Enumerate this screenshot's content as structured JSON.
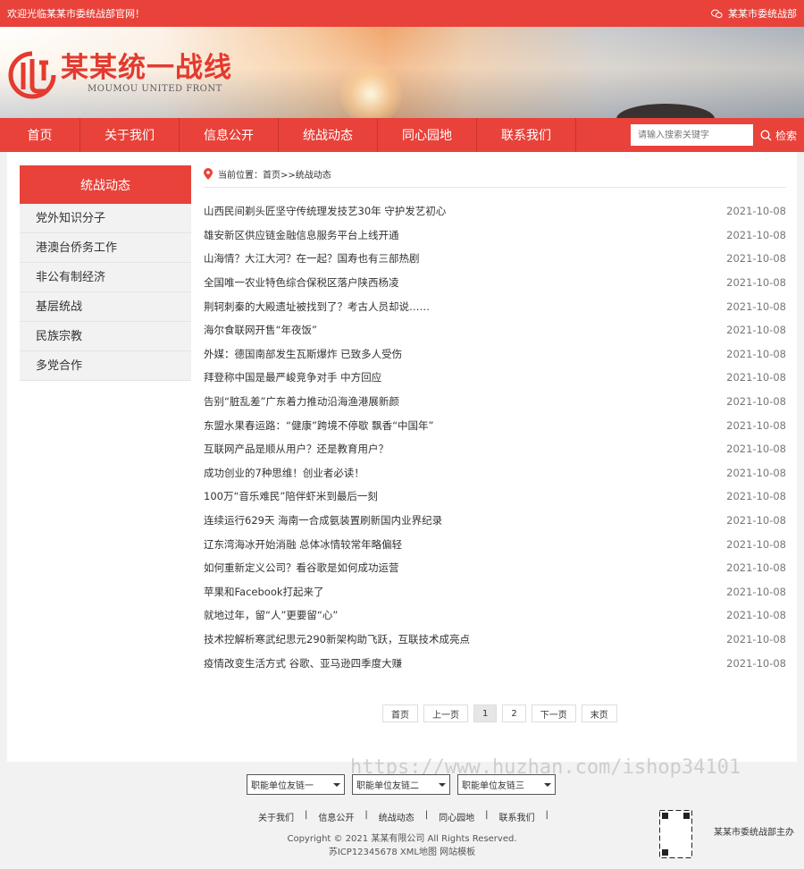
{
  "topbar": {
    "welcome": "欢迎光临某某市委统战部官网！",
    "right_text": "某某市委统战部"
  },
  "logo": {
    "cn": "某某统一战线",
    "en": "MOUMOU UNITED FRONT"
  },
  "nav": {
    "items": [
      "首页",
      "关于我们",
      "信息公开",
      "统战动态",
      "同心园地",
      "联系我们"
    ],
    "search_placeholder": "请输入搜索关键字",
    "search_label": "检索"
  },
  "sidebar": {
    "title": "统战动态",
    "items": [
      "党外知识分子",
      "港澳台侨务工作",
      "非公有制经济",
      "基层统战",
      "民族宗教",
      "多党合作"
    ]
  },
  "breadcrumb": {
    "text": "当前位置：首页>>统战动态"
  },
  "news": [
    {
      "title": "山西民间剃头匠坚守传统理发技艺30年 守护发艺初心",
      "date": "2021-10-08"
    },
    {
      "title": "雄安新区供应链金融信息服务平台上线开通",
      "date": "2021-10-08"
    },
    {
      "title": "山海情？大江大河？在一起？国寿也有三部热剧",
      "date": "2021-10-08"
    },
    {
      "title": "全国唯一农业特色综合保税区落户陕西杨凌",
      "date": "2021-10-08"
    },
    {
      "title": "荆轲刺秦的大殿遗址被找到了？考古人员却说……",
      "date": "2021-10-08"
    },
    {
      "title": "海尔食联网开售“年夜饭”",
      "date": "2021-10-08"
    },
    {
      "title": "外媒：德国南部发生瓦斯爆炸 已致多人受伤",
      "date": "2021-10-08"
    },
    {
      "title": "拜登称中国是最严峻竞争对手 中方回应",
      "date": "2021-10-08"
    },
    {
      "title": "告别“脏乱差”广东着力推动沿海渔港展新颜",
      "date": "2021-10-08"
    },
    {
      "title": "东盟水果春运路：“健康”跨境不停歇 飘香“中国年”",
      "date": "2021-10-08"
    },
    {
      "title": "互联网产品是顺从用户？还是教育用户？",
      "date": "2021-10-08"
    },
    {
      "title": "成功创业的7种思维！创业者必读！",
      "date": "2021-10-08"
    },
    {
      "title": "100万“音乐难民”陪伴虾米到最后一刻",
      "date": "2021-10-08"
    },
    {
      "title": "连续运行629天 海南一合成氨装置刷新国内业界纪录",
      "date": "2021-10-08"
    },
    {
      "title": "辽东湾海冰开始消融 总体冰情较常年略偏轻",
      "date": "2021-10-08"
    },
    {
      "title": "如何重新定义公司？看谷歌是如何成功运营",
      "date": "2021-10-08"
    },
    {
      "title": "苹果和Facebook打起来了",
      "date": "2021-10-08"
    },
    {
      "title": "就地过年，留“人”更要留“心”",
      "date": "2021-10-08"
    },
    {
      "title": "技术控解析寒武纪思元290新架构助飞跃，互联技术成亮点",
      "date": "2021-10-08"
    },
    {
      "title": "疫情改变生活方式 谷歌、亚马逊四季度大赚",
      "date": "2021-10-08"
    }
  ],
  "pager": {
    "first": "首页",
    "prev": "上一页",
    "pages": [
      "1",
      "2"
    ],
    "current": "1",
    "next": "下一页",
    "last": "末页"
  },
  "watermark": "https://www.huzhan.com/ishop34101",
  "footer": {
    "selects": [
      "职能单位友链一",
      "职能单位友链二",
      "职能单位友链三"
    ],
    "links": [
      "关于我们",
      "信息公开",
      "统战动态",
      "同心园地",
      "联系我们"
    ],
    "copyright": "Copyright © 2021 某某有限公司 All Rights Reserved.",
    "icp": "苏ICP12345678 XML地图 网站模板",
    "host": "某某市委统战部主办"
  },
  "colors": {
    "brand_red": "#e8423a"
  }
}
